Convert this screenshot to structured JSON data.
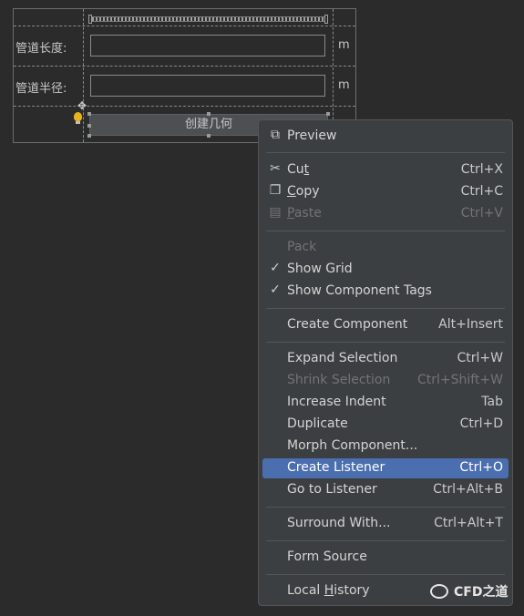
{
  "form": {
    "length_label": "管道长度:",
    "radius_label": "管道半径:",
    "unit_length": "m",
    "unit_radius": "m",
    "length_value": "",
    "radius_value": "",
    "create_button": "创建几何"
  },
  "menu": {
    "preview": "Preview",
    "cut": {
      "pre": "Cu",
      "ul": "t",
      "post": "",
      "shortcut": "Ctrl+X"
    },
    "copy": {
      "pre": "",
      "ul": "C",
      "post": "opy",
      "shortcut": "Ctrl+C"
    },
    "paste": {
      "pre": "",
      "ul": "P",
      "post": "aste",
      "shortcut": "Ctrl+V"
    },
    "pack": "Pack",
    "show_grid": "Show Grid",
    "show_component_tags": "Show Component Tags",
    "create_component": {
      "label": "Create Component",
      "shortcut": "Alt+Insert"
    },
    "expand_selection": {
      "label": "Expand Selection",
      "shortcut": "Ctrl+W"
    },
    "shrink_selection": {
      "label": "Shrink Selection",
      "shortcut": "Ctrl+Shift+W"
    },
    "increase_indent": {
      "label": "Increase Indent",
      "shortcut": "Tab"
    },
    "duplicate": {
      "label": "Duplicate",
      "shortcut": "Ctrl+D"
    },
    "morph_component": {
      "label": "Morph Component..."
    },
    "create_listener": {
      "label": "Create Listener",
      "shortcut": "Ctrl+O"
    },
    "go_to_listener": {
      "label": "Go to Listener",
      "shortcut": "Ctrl+Alt+B"
    },
    "surround_with": {
      "label": "Surround With...",
      "shortcut": "Ctrl+Alt+T"
    },
    "form_source": {
      "label": "Form Source"
    },
    "local_history": {
      "pre": "Local ",
      "ul": "H",
      "post": "istory"
    }
  },
  "watermark": "CFD之道",
  "colors": {
    "selected": "#4b6eaf",
    "menu_bg": "#3c3f41",
    "canvas": "#2b2b2b"
  }
}
